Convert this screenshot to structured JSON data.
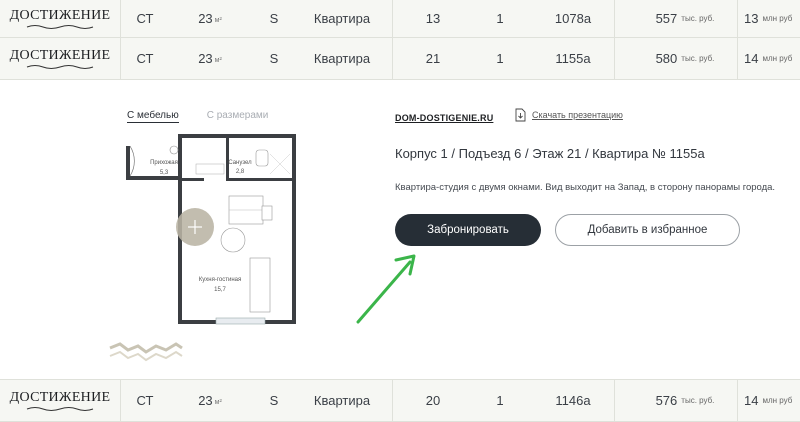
{
  "rows": [
    {
      "logo": "ДОСТИЖЕНИЕ",
      "type": "СТ",
      "area": "23",
      "area_unit": "м²",
      "orientation": "S",
      "kind": "Квартира",
      "floor": "13",
      "entrance": "1",
      "number": "1078а",
      "price_per_m": "557",
      "price_per_m_unit": "тыс. руб.",
      "price": "13",
      "price_unit": "млн руб"
    },
    {
      "logo": "ДОСТИЖЕНИЕ",
      "type": "СТ",
      "area": "23",
      "area_unit": "м²",
      "orientation": "S",
      "kind": "Квартира",
      "floor": "21",
      "entrance": "1",
      "number": "1155а",
      "price_per_m": "580",
      "price_per_m_unit": "тыс. руб.",
      "price": "14",
      "price_unit": "млн руб"
    },
    {
      "logo": "ДОСТИЖЕНИЕ",
      "type": "СТ",
      "area": "23",
      "area_unit": "м²",
      "orientation": "S",
      "kind": "Квартира",
      "floor": "20",
      "entrance": "1",
      "number": "1146а",
      "price_per_m": "576",
      "price_per_m_unit": "тыс. руб.",
      "price": "14",
      "price_unit": "млн руб"
    }
  ],
  "detail": {
    "tabs": {
      "furniture": "С мебелью",
      "dimensions": "С размерами"
    },
    "plan": {
      "hallway_label": "Прихожая",
      "hallway_area": "5,3",
      "bathroom_label": "Санузел",
      "bathroom_area": "2,8",
      "living_label": "Кухня-гостиная",
      "living_area": "15,7"
    },
    "site_link": "DOM-DOSTIGENIE.RU",
    "download_label": "Скачать презентацию",
    "apartment_title": "Корпус 1 / Подъезд 6 / Этаж 21 / Квартира № 1155а",
    "description": "Квартира-студия с двумя окнами. Вид выходит на Запад, в сторону панорамы города.",
    "book_button": "Забронировать",
    "favorite_button": "Добавить в избранное"
  },
  "colors": {
    "accent_dark": "#262e36",
    "arrow_green": "#3bb54a",
    "zoom_button": "#b9b4a4",
    "row_bg": "#f6f7f3"
  },
  "icons": {
    "zoom": "plus-icon",
    "download": "document-download-icon",
    "arrow": "green-arrow-icon"
  }
}
